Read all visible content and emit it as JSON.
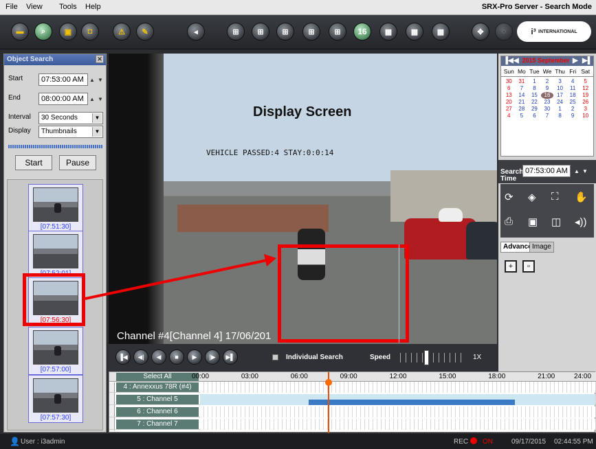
{
  "menu": {
    "file": "File",
    "view": "View",
    "tools": "Tools",
    "help": "Help"
  },
  "app_title": "SRX-Pro Server - Search Mode",
  "toolbar": {
    "grid_16": "16",
    "logo_mark": "i³",
    "logo_sub": "INTERNATIONAL"
  },
  "object_search": {
    "title": "Object Search",
    "start_label": "Start",
    "start_value": "07:53:00 AM",
    "end_label": "End",
    "end_value": "08:00:00 AM",
    "interval_label": "Interval",
    "interval_value": "30 Seconds",
    "display_label": "Display",
    "display_value": "Thumbnails",
    "start_button": "Start",
    "pause_button": "Pause"
  },
  "thumbnails": [
    {
      "time": "[07:51:30]"
    },
    {
      "time": "[07:52:01]"
    },
    {
      "time": "[07:56:30]"
    },
    {
      "time": "[07:57:00]"
    },
    {
      "time": "[07:57:30]"
    }
  ],
  "video": {
    "title": "Display Screen",
    "osd": "VEHICLE PASSED:4    STAY:0:0:14",
    "channel_label": "Channel #4[Channel 4] 17/06/201"
  },
  "calendar": {
    "month": "2015 September",
    "days": [
      "Sun",
      "Mo",
      "Tue",
      "We",
      "Thu",
      "Fri",
      "Sat"
    ],
    "dates": [
      "30",
      "31",
      "1",
      "2",
      "3",
      "4",
      "5",
      "6",
      "7",
      "8",
      "9",
      "10",
      "11",
      "12",
      "13",
      "14",
      "15",
      "16",
      "17",
      "18",
      "19",
      "20",
      "21",
      "22",
      "23",
      "24",
      "25",
      "26",
      "27",
      "28",
      "29",
      "30",
      "1",
      "2",
      "3",
      "4",
      "5",
      "6",
      "7",
      "8",
      "9",
      "10"
    ],
    "today": "16"
  },
  "search_time": {
    "label": "Search Time",
    "value": "07:53:00 AM"
  },
  "tabs": {
    "advance": "Advance",
    "image": "Image"
  },
  "playback": {
    "individual_search": "Individual Search",
    "speed_label": "Speed",
    "speed_value": "1X",
    "speed_level": 0.5
  },
  "timeline": {
    "select_all": "Select All",
    "hours": [
      "00:00",
      "03:00",
      "06:00",
      "09:00",
      "12:00",
      "15:00",
      "18:00",
      "21:00",
      "24:00"
    ],
    "channels": [
      "4 : Annexxus 78R (#4)",
      "5 : Channel 5",
      "6 : Channel 6",
      "7 : Channel 7"
    ],
    "cursor_time": "08:00"
  },
  "status": {
    "user": "User : i3admin",
    "rec": "REC",
    "on": "ON",
    "date": "09/17/2015",
    "time": "02:44:55 PM"
  }
}
